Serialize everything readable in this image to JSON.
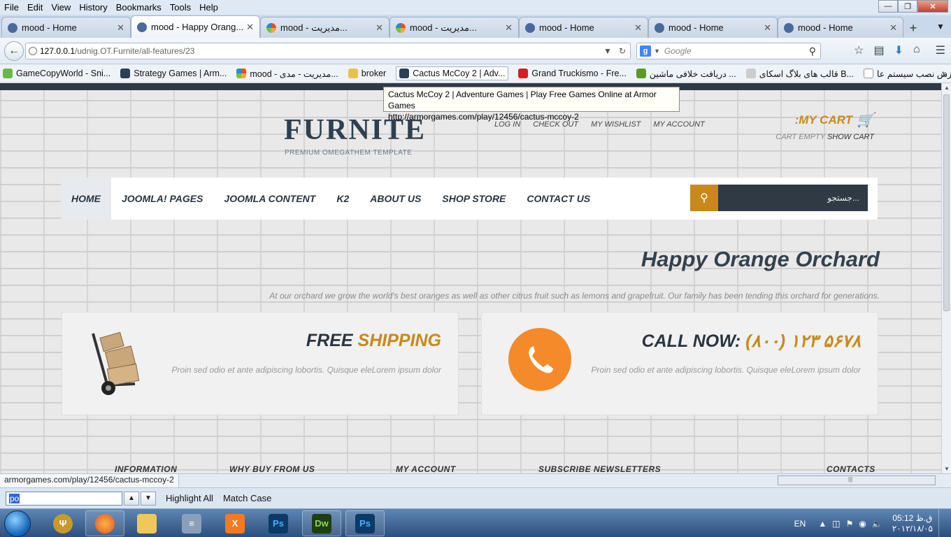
{
  "menu": [
    "File",
    "Edit",
    "View",
    "History",
    "Bookmarks",
    "Tools",
    "Help"
  ],
  "tabs": [
    {
      "label": "mood - Home",
      "icon": "site-icon",
      "active": false
    },
    {
      "label": "mood - Happy Orang...",
      "icon": "site-icon",
      "active": true
    },
    {
      "label": "mood - مدیریت...",
      "icon": "joomla-icon",
      "active": false
    },
    {
      "label": "mood - مدیریت...",
      "icon": "joomla-icon",
      "active": false
    },
    {
      "label": "mood - Home",
      "icon": "site-icon",
      "active": false
    },
    {
      "label": "mood - Home",
      "icon": "site-icon",
      "active": false
    },
    {
      "label": "mood - Home",
      "icon": "site-icon",
      "active": false
    }
  ],
  "url": {
    "host": "127.0.0.1",
    "path": "/udnig.OT.Furnite/all-features/23"
  },
  "search": {
    "placeholder": "Google"
  },
  "bookmarks": [
    {
      "label": "GameCopyWorld - Sni...",
      "color": "#6bb84a"
    },
    {
      "label": "Strategy Games | Arm...",
      "color": "#2c3f55"
    },
    {
      "label": "mood - مدیریت - مدی...",
      "color": "#e94e1b"
    },
    {
      "label": "broker",
      "color": "#e8c24a"
    },
    {
      "label": "Cactus McCoy 2 | Adv...",
      "color": "#2c3f55"
    },
    {
      "label": "Grand Truckismo - Fre...",
      "color": "#d42020"
    },
    {
      "label": "دریافت خلافی ماشین ...",
      "color": "#5a9a2a"
    },
    {
      "label": "قالب های بلاگ اسکای B...",
      "color": "#cccccc"
    },
    {
      "label": "آموزش نصب سیستم عا...",
      "color": "#ffffff"
    }
  ],
  "tooltip": {
    "title": "Cactus McCoy 2 | Adventure Games | Play Free Games Online at Armor Games",
    "url": "http://armorgames.com/play/12456/cactus-mccoy-2"
  },
  "site": {
    "logo": "FURNITE",
    "tagline": "PREMIUM OMEGATHEM TEMPLATE",
    "toplinks": [
      "LOG IN",
      "CHECK OUT",
      "MY WISHLIST",
      "MY ACCOUNT"
    ],
    "cart_title": ":MY CART",
    "cart_empty": "CART EMPTY",
    "cart_show": "SHOW CART",
    "nav": [
      "HOME",
      "JOOMLA! PAGES",
      "JOOMLA CONTENT",
      "K2",
      "ABOUT US",
      "SHOP STORE",
      "CONTACT US"
    ],
    "search_placeholder": "جستجو...",
    "hero_title": "Happy Orange Orchard",
    "hero_text": "At our orchard we grow the world's best oranges as well as other citrus fruit such as lemons and grapefruit. Our family has been tending this orchard for generations.",
    "card1": {
      "title": "FREE ",
      "accent": "SHIPPING",
      "text": "Proin sed odio et ante adipiscing lobortis. Quisque eleLorem ipsum dolor"
    },
    "card2": {
      "title": "CALL NOW: ",
      "accent": "(۸۰۰) ۱۲۳ ۵۶۷۸",
      "text": "Proin sed odio et ante adipiscing lobortis. Quisque eleLorem ipsum dolor"
    },
    "footer": [
      "INFORMATION",
      "WHY BUY FROM US",
      "MY ACCOUNT",
      "SUBSCRIBE NEWSLETTERS",
      "CONTACTS"
    ],
    "accent_color": "#c8891a"
  },
  "status": {
    "url": "armorgames.com/play/12456/cactus-mccoy-2"
  },
  "find": {
    "value": "po",
    "highlight_all": "Highlight All",
    "match_case": "Match Case"
  },
  "tray": {
    "lang": "EN",
    "time": "05:12 ق.ظ",
    "date": "۲۰۱۲/۱۸/۰۵"
  }
}
